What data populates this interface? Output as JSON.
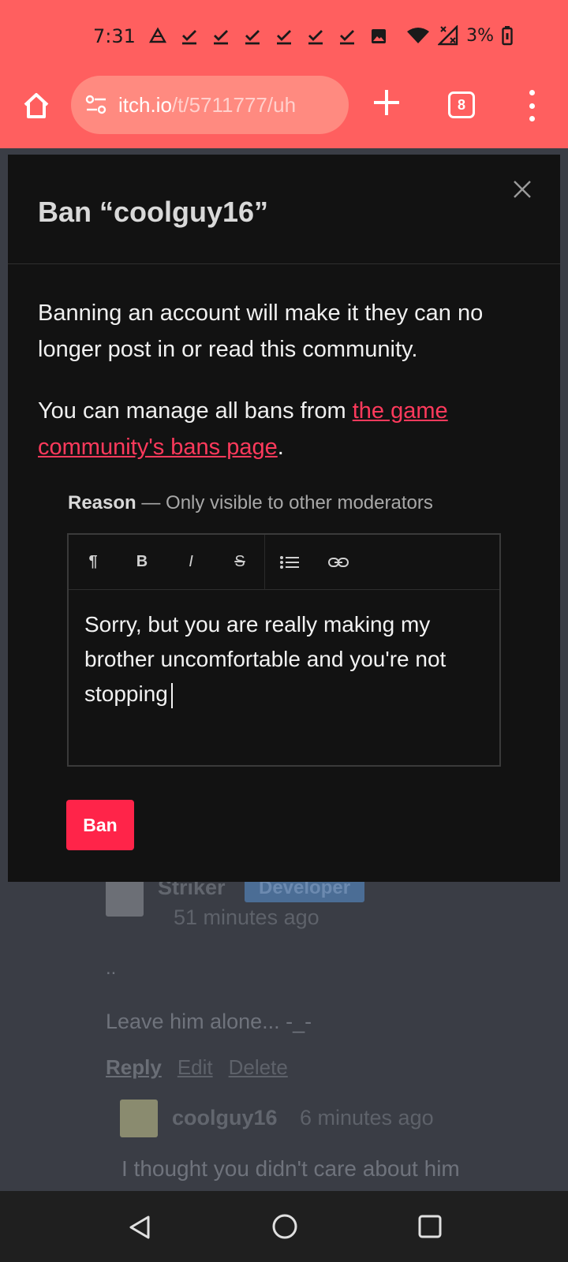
{
  "status_bar": {
    "time": "7:31",
    "battery": "3%",
    "icons": [
      "drive-icon",
      "check-icon",
      "check-icon",
      "check-icon",
      "check-icon",
      "check-icon",
      "check-icon",
      "image-icon",
      "wifi-icon",
      "no-signal-icon",
      "battery-icon"
    ]
  },
  "browser": {
    "url_domain": "itch.io",
    "url_path": "/t/5711777/uh",
    "tab_count": "8",
    "icons": [
      "home-icon",
      "site-settings-icon",
      "new-tab-icon",
      "tabs-icon",
      "more-menu-icon"
    ]
  },
  "modal": {
    "title": "Ban “coolguy16”",
    "paragraph1": "Banning an account will make it they can no longer post in or read this community.",
    "paragraph2_prefix": "You can manage all bans from ",
    "paragraph2_link": "the game community's bans page",
    "paragraph2_suffix": ".",
    "reason_label": "Reason",
    "reason_hint": " — Only visible to other moderators",
    "reason_text": "Sorry, but you are really making my brother uncomfortable and you're not stopping",
    "toolbar": {
      "paragraph": "¶",
      "bold": "B",
      "italic": "I",
      "strikethrough": "S"
    },
    "ban_button": "Ban",
    "accent_color": "#ff2449"
  },
  "background_thread": {
    "comment": {
      "author": "Striker",
      "badge": "Developer",
      "time": "51 minutes ago",
      "line1": "..",
      "line2": "Leave him alone... -_-",
      "actions": [
        "Reply",
        "Edit",
        "Delete"
      ]
    },
    "reply": {
      "author": "coolguy16",
      "time": "6 minutes ago",
      "text": "I thought you didn't care about him"
    }
  }
}
